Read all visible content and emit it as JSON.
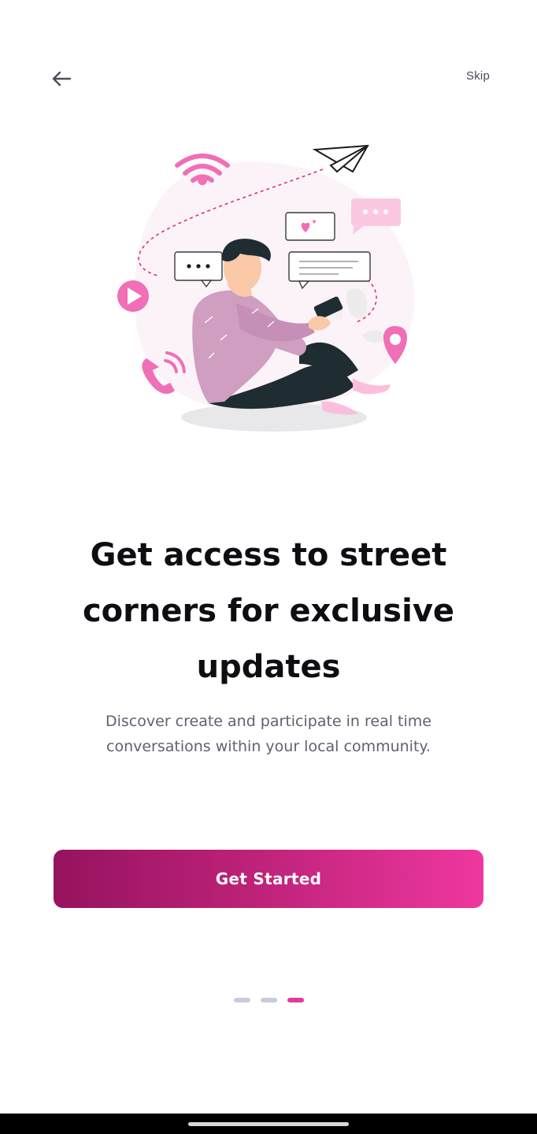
{
  "header": {
    "back_icon": "arrow-left-icon",
    "skip_label": "Skip"
  },
  "illustration": {
    "description_icon": "person-with-phone-illustration"
  },
  "content": {
    "title": "Get access to street corners for exclusive updates",
    "subtitle": "Discover create and participate in real time conversations within your local community."
  },
  "cta": {
    "label": "Get Started"
  },
  "pagination": {
    "total": 3,
    "active_index": 2
  },
  "colors": {
    "accent_start": "#96135e",
    "accent_end": "#ef37a0",
    "dot_inactive": "#c9cbdc",
    "dot_active": "#e2399a",
    "illustration_pink": "#f06fb6"
  }
}
